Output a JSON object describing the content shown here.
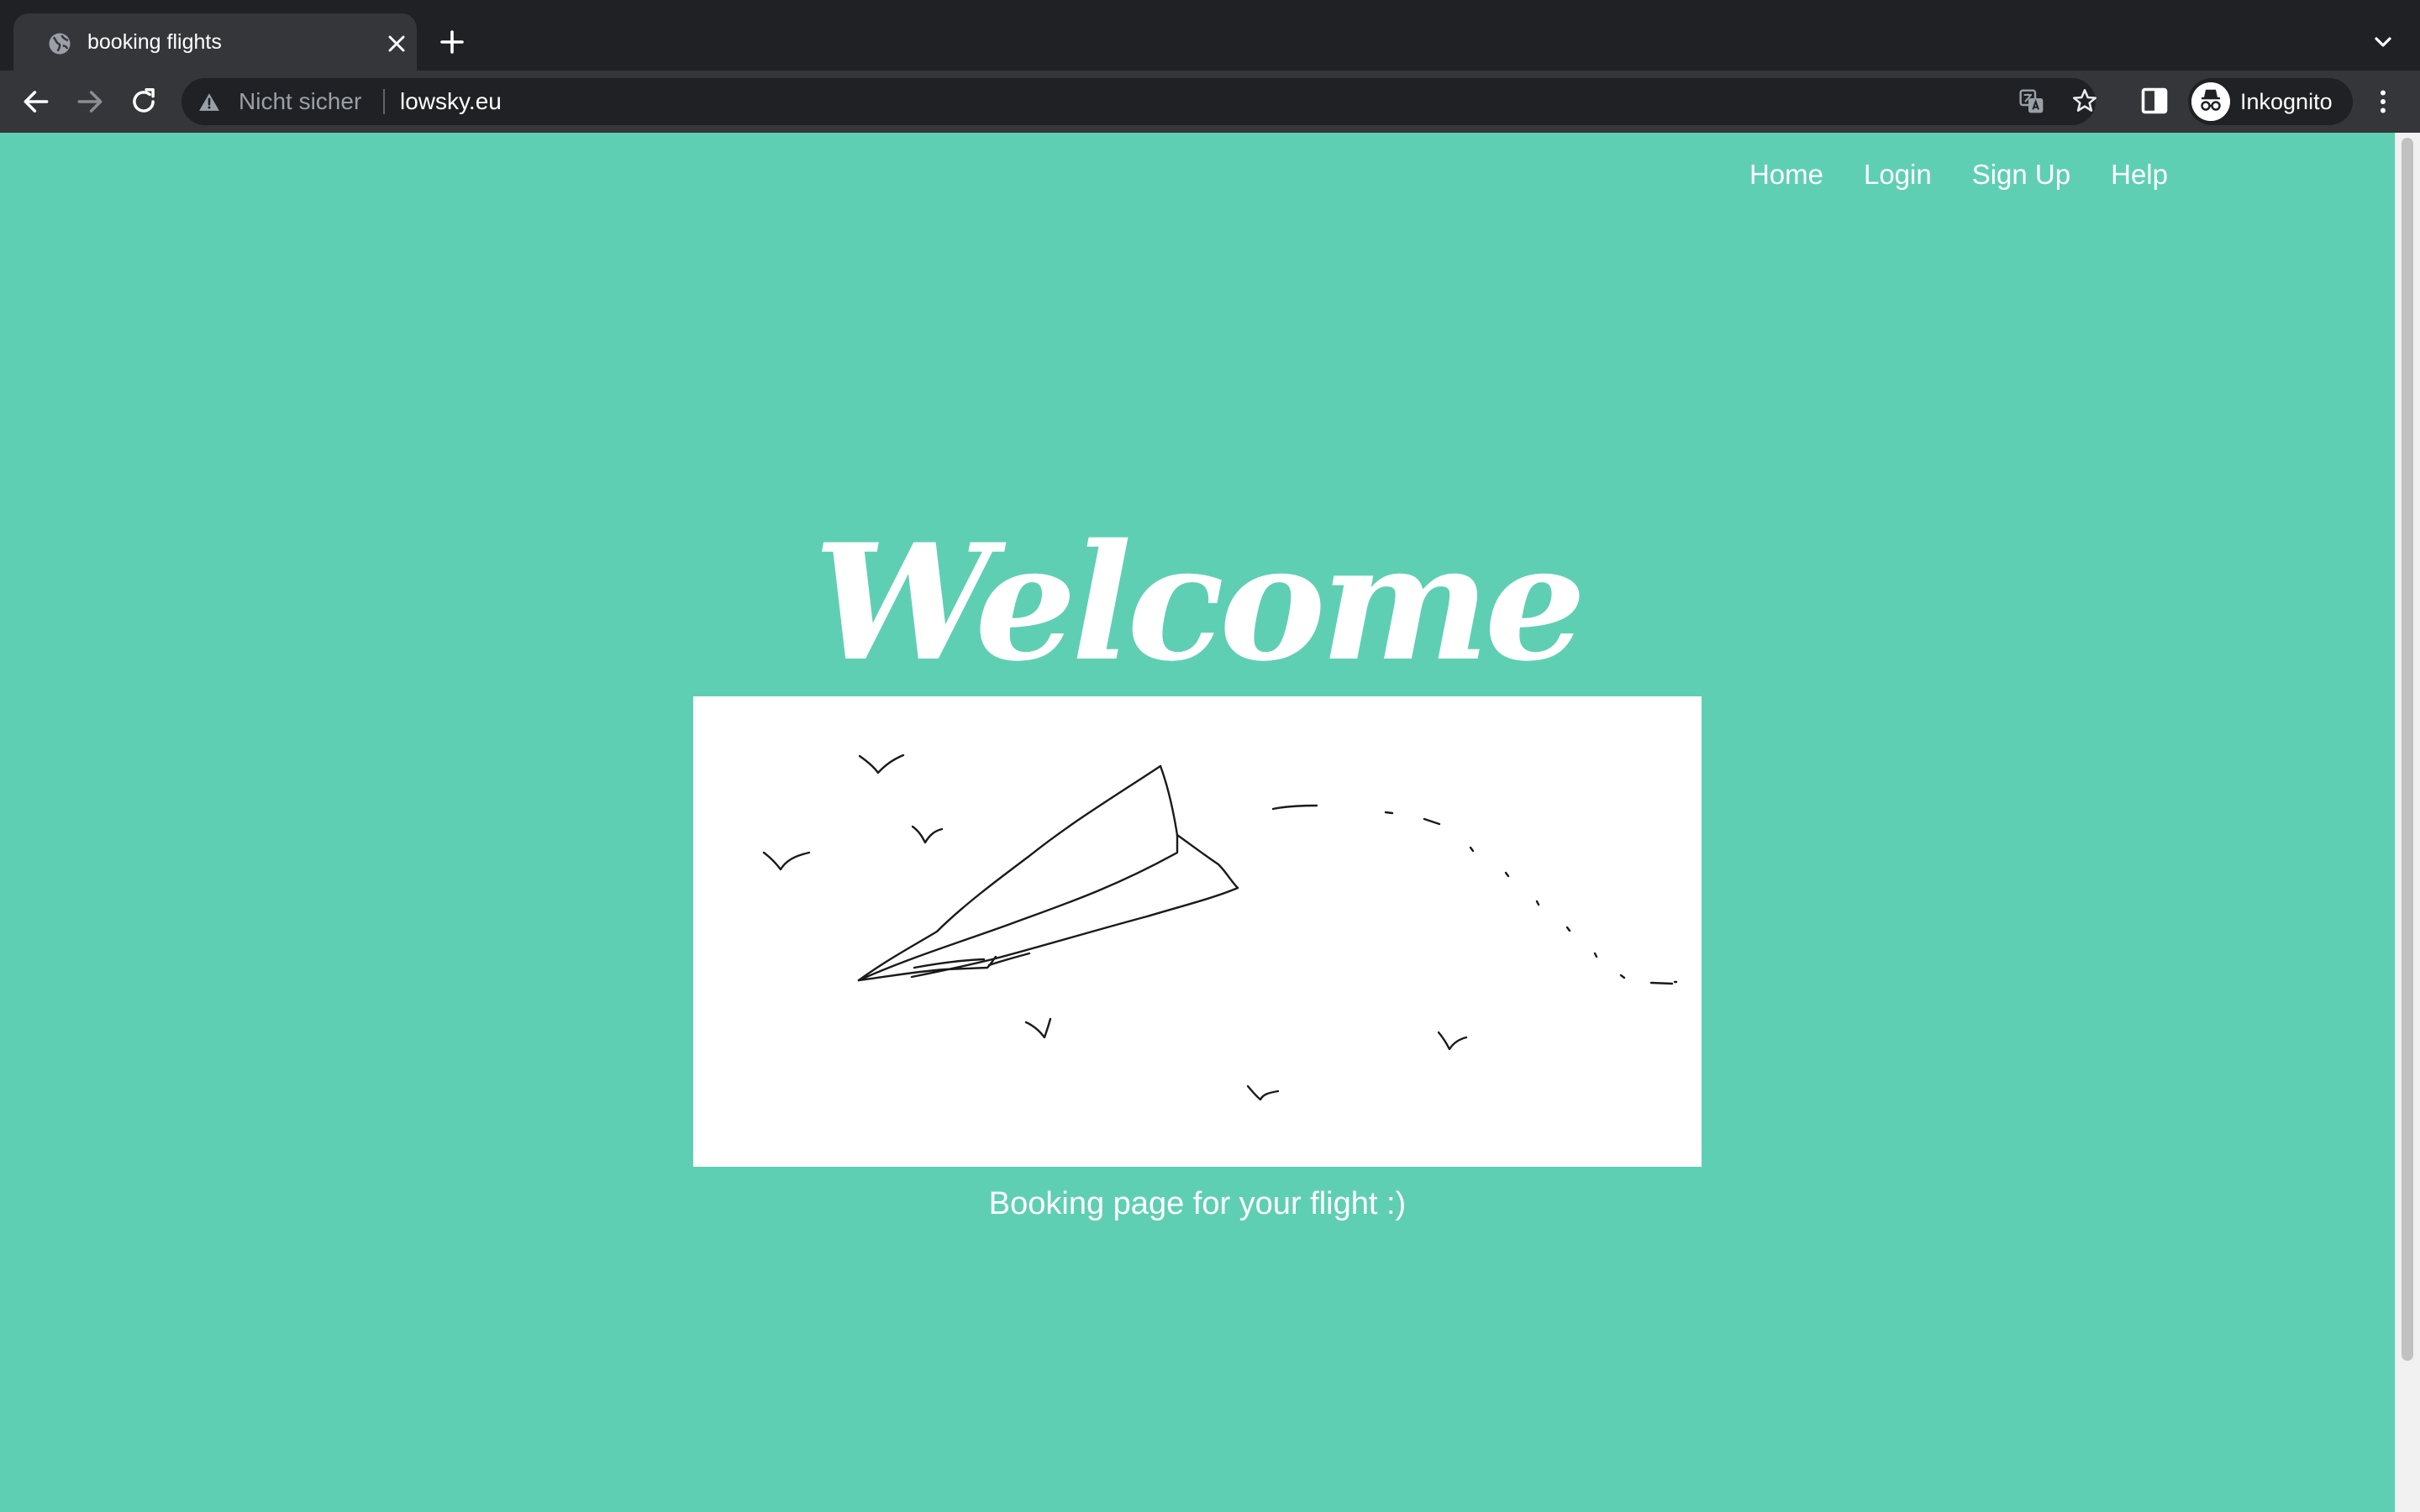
{
  "browser": {
    "tab": {
      "title": "booking flights",
      "favicon": "globe-icon",
      "close_icon": "close-icon"
    },
    "new_tab_icon": "plus-icon",
    "tab_search_icon": "chevron-down-icon",
    "toolbar": {
      "back_icon": "back-arrow-icon",
      "forward_icon": "forward-arrow-icon",
      "reload_icon": "reload-icon",
      "security_label": "Nicht sicher",
      "url": "lowsky.eu",
      "translate_icon": "translate-icon",
      "bookmark_icon": "star-icon",
      "side_panel_icon": "side-panel-icon",
      "profile_label": "Inkognito",
      "menu_icon": "kebab-menu-icon"
    }
  },
  "page": {
    "background": "#5fcfb3",
    "nav": {
      "items": [
        "Home",
        "Login",
        "Sign Up",
        "Help"
      ]
    },
    "hero": {
      "title": "Welcome",
      "caption": "Booking page for your flight :)"
    }
  }
}
